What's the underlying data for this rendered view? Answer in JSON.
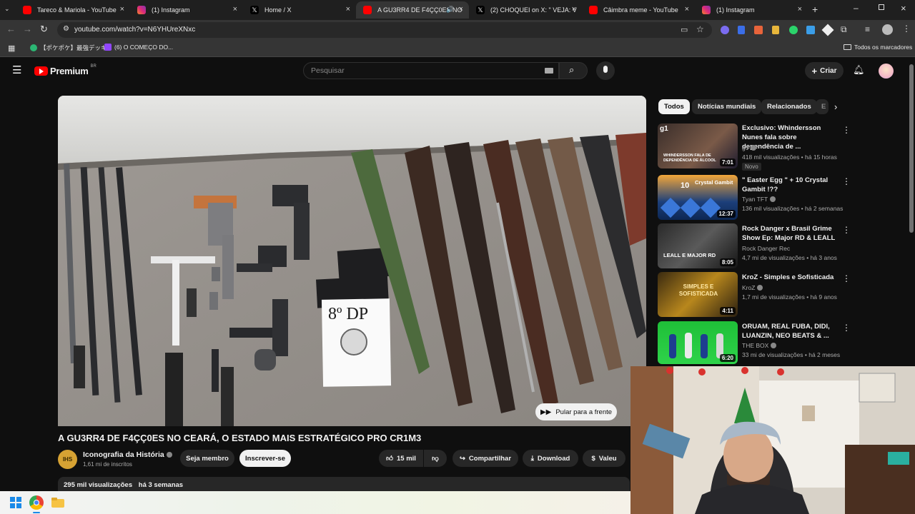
{
  "browser": {
    "tabs": [
      {
        "title": "Tareco & Mariola - YouTube",
        "favicon": "youtube-icon",
        "color": "#ff0000"
      },
      {
        "title": "(1) Instagram",
        "favicon": "instagram-icon",
        "color": "#d6249f"
      },
      {
        "title": "Home / X",
        "favicon": "x-icon",
        "color": "#000000"
      },
      {
        "title": "A GU3RR4 DE F4ÇÇ0ES NO",
        "favicon": "youtube-icon",
        "color": "#ff0000"
      },
      {
        "title": "(2) CHOQUEI on X: \" VEJA: V",
        "favicon": "x-icon",
        "color": "#000000"
      },
      {
        "title": "Câimbra meme - YouTube",
        "favicon": "youtube-icon",
        "color": "#ff0000"
      },
      {
        "title": "(1) Instagram",
        "favicon": "instagram-icon",
        "color": "#d6249f"
      }
    ],
    "url": "youtube.com/watch?v=N6YHUreXNxc",
    "bookmarks": [
      {
        "label": "【ポケポケ】最強デッキ...",
        "icon": "bookmark-site-icon"
      },
      {
        "label": "(6) O COMEÇO DO...",
        "icon": "twitch-icon"
      }
    ],
    "all_bookmarks": "Todos os marcadores"
  },
  "youtube": {
    "logo_text": "Premium",
    "region": "BR",
    "search_placeholder": "Pesquisar",
    "create_label": "Criar",
    "chips": [
      "Todos",
      "Notícias mundiais",
      "Relacionados",
      "E"
    ],
    "video": {
      "title": "A GU3RR4 DE F4ÇÇ0ES NO CEARÁ, O ESTADO MAIS ESTRATÉGICO PRO CR1M3",
      "skip_label": "Pular para a frente",
      "sign_text": "8º DP",
      "channel_initials": "IHS",
      "channel_name": "Iconografia da História",
      "subscribers": "1,61 mi de inscritos",
      "join_label": "Seja membro",
      "subscribe_label": "Inscrever-se",
      "likes": "15 mil",
      "share_label": "Compartilhar",
      "download_label": "Download",
      "thanks_label": "Valeu",
      "views": "295 mil visualizações",
      "age": "há 3 semanas"
    },
    "recommendations": [
      {
        "title": "Exclusivo: Whindersson Nunes fala sobre dependência de ...",
        "channel": "g1",
        "meta": "418 mil visualizações • há 15 horas",
        "duration": "7:01",
        "badge": "Novo",
        "thumb_text": "g1",
        "thumb_caption": "WHINDERSSON FALA DE DEPENDÊNCIA DE ÁLCOOL"
      },
      {
        "title": "\" Easter Egg \" + 10 Crystal Gambit !??",
        "channel": "Tyan TFT",
        "meta": "136 mil visualizações • há 2 semanas",
        "duration": "12:37",
        "thumb_text": "Crystal Gambit",
        "thumb_number": "10"
      },
      {
        "title": "Rock Danger x Brasil Grime Show Ep: Major RD & LEALL",
        "channel": "Rock Danger Rec",
        "meta": "4,7 mi de visualizações • há 3 anos",
        "duration": "8:05",
        "thumb_text": "LEALL E MAJOR RD"
      },
      {
        "title": "KroZ - Simples e Sofisticada",
        "channel": "KroZ",
        "meta": "1,7 mi de visualizações • há 9 anos",
        "duration": "4:11",
        "thumb_text": "SIMPLES E SOFISTICADA"
      },
      {
        "title": "ORUAM, REAL FUBA, DIDI, LUANZIN, NEO BEATS & ...",
        "channel": "THE BOX",
        "meta": "33 mi de visualizações • há 2 meses",
        "duration": "6:20"
      }
    ]
  }
}
